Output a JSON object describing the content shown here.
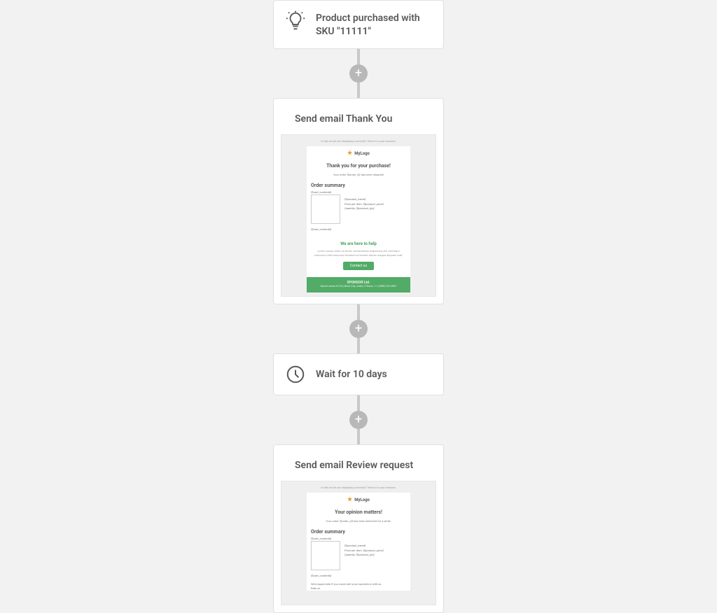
{
  "flow": {
    "trigger": {
      "title": "Product purchased with SKU \"11111\""
    },
    "email1": {
      "title": "Send email Thank You",
      "preview": {
        "topline": "Is this email not displaying correctly? View it in your browser.",
        "logo": "MyLogo",
        "heading": "Thank you for your purchase!",
        "subline": "Your order {$order_id} has been shipped!",
        "summary_label": "Order summary",
        "tag_open": "{$cart_contents}",
        "meta_name": "{$product_name}",
        "meta_price": "Price per item: {$product_price}",
        "meta_qty": "Quantity: {$product_qty}",
        "tag_close": "{$cart_contents}",
        "help_title": "We are here to help",
        "help_text": "Lorem ipsum dolor sit amet, consectetuer adipiscing elit, sed diam nonummy nibh euismod tincidunt ut laoreet dolore magna aliquam erat.",
        "button": "Contact us",
        "footer_name": "SPONSOR Ltd.",
        "footer_addr": "Street name 0123 | Best City, state | Phone: +1 (555)123-4567"
      }
    },
    "delay": {
      "title": "Wait for 10 days"
    },
    "email2": {
      "title": "Send email Review request",
      "preview": {
        "topline": "Is this email not displaying correctly? View it in your browser.",
        "logo": "MyLogo",
        "heading": "Your opinion matters!",
        "subline": "Your order {$order_id} has been delivered for a while.",
        "summary_label": "Order summary",
        "tag_open": "{$cart_contents}",
        "meta_name": "{$product_name}",
        "meta_price": "Price per item: {$product_price}",
        "meta_qty": "Quantity: {$product_qty}",
        "tag_close": "{$cart_contents}",
        "review_prompt": "We'd appreciate if you could rate your experience with us.",
        "review_cta": "Rate us"
      }
    }
  },
  "icons": {
    "idea": "idea-icon",
    "email": "email-icon",
    "clock": "clock-icon",
    "plus": "plus-icon"
  }
}
